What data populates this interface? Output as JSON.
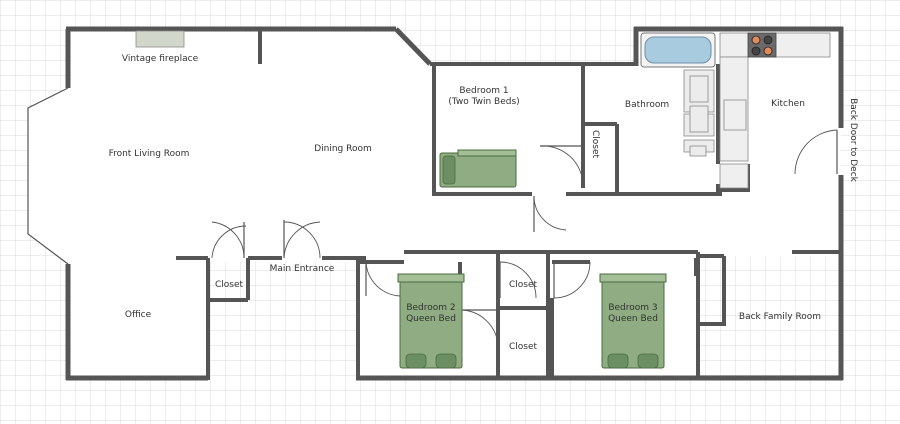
{
  "rooms": {
    "front_living": "Front Living Room",
    "dining": "Dining Room",
    "fireplace": "Vintage fireplace",
    "bedroom1_line1": "Bedroom 1",
    "bedroom1_line2": "(Two Twin Beds)",
    "closet_b1": "Closet",
    "bathroom": "Bathroom",
    "kitchen": "Kitchen",
    "back_door": "Back Door to Deck",
    "closet_entry": "Closet",
    "main_entrance": "Main Entrance",
    "office": "Office",
    "bedroom2_line1": "Bedroom 2",
    "bedroom2_line2": "Queen Bed",
    "closet_top": "Closet",
    "closet_bottom": "Closet",
    "bedroom3_line1": "Bedroom 3",
    "bedroom3_line2": "Queen Bed",
    "back_family": "Back Family Room"
  },
  "colors": {
    "wall": "#555555",
    "grid": "#c8c8c8",
    "bed": "#8fac82",
    "bed_dark": "#6c8e63",
    "tub": "#a9cbe0",
    "fixture": "#e6e6e6"
  }
}
